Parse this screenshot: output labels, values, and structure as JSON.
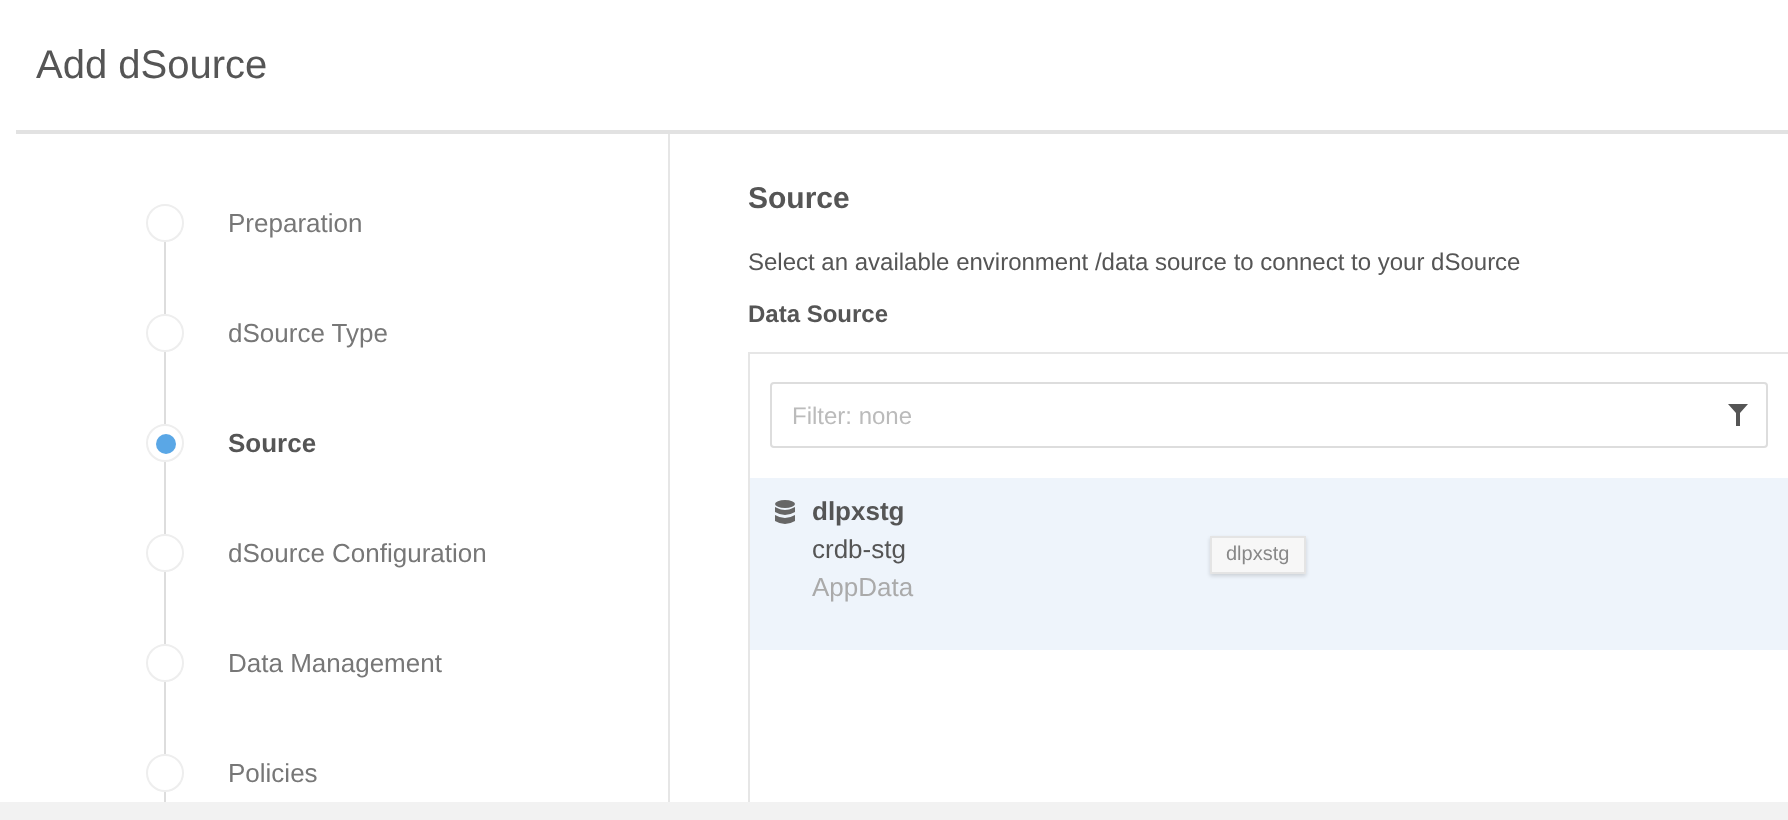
{
  "page": {
    "title": "Add dSource"
  },
  "steps": [
    {
      "label": "Preparation",
      "selected": false
    },
    {
      "label": "dSource Type",
      "selected": false
    },
    {
      "label": "Source",
      "selected": true
    },
    {
      "label": "dSource Configuration",
      "selected": false
    },
    {
      "label": "Data Management",
      "selected": false
    },
    {
      "label": "Policies",
      "selected": false
    }
  ],
  "section": {
    "heading": "Source",
    "description": "Select an available environment /data source to connect to your dSource",
    "field_label": "Data Source"
  },
  "filter": {
    "placeholder": "Filter: none"
  },
  "sources": [
    {
      "name": "dlpxstg",
      "host": "crdb-stg",
      "type": "AppData",
      "selected": true,
      "tooltip": "dlpxstg"
    }
  ]
}
